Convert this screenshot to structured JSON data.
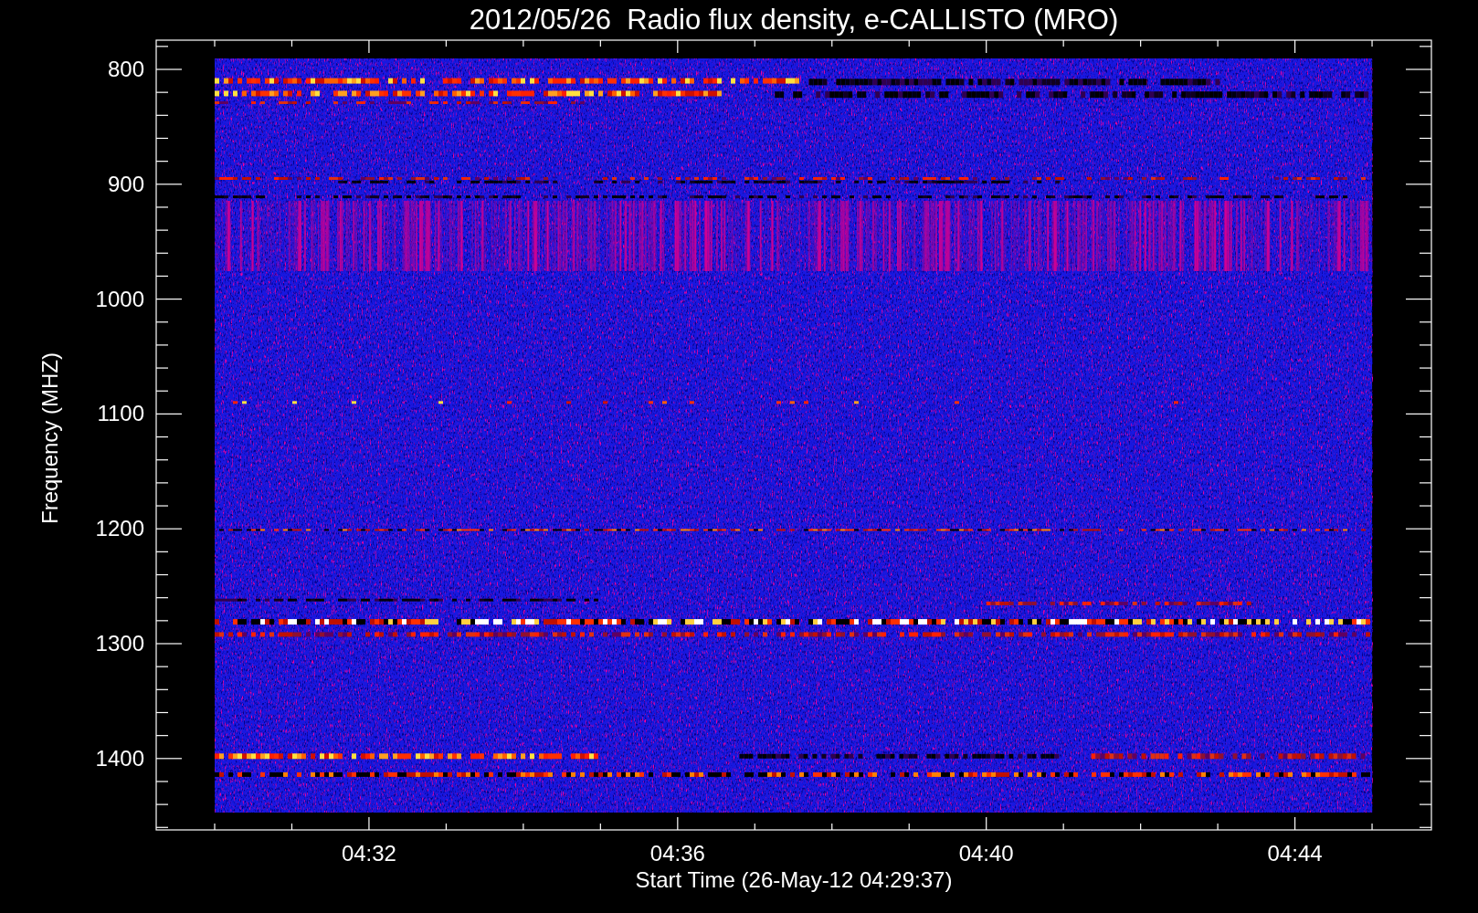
{
  "title": "2012/05/26  Radio flux density, e-CALLISTO (MRO)",
  "y_axis": {
    "label": "Frequency (MHZ)",
    "ticks": [
      "800",
      "900",
      "1000",
      "1100",
      "1200",
      "1300",
      "1400"
    ]
  },
  "x_axis": {
    "label": "Start Time (26-May-12 04:29:37)",
    "ticks": [
      "04:32",
      "04:36",
      "04:40",
      "04:44"
    ]
  }
}
